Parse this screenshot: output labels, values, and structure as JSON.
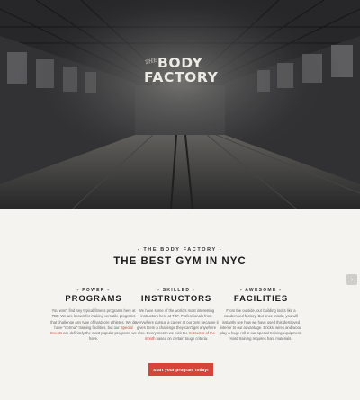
{
  "logo": {
    "the": "THE",
    "line1": "BODY",
    "line2": "FACTORY"
  },
  "intro": {
    "eyebrow": "- THE BODY FACTORY -",
    "headline": "THE BEST GYM IN NYC"
  },
  "features": [
    {
      "kicker": "- POWER -",
      "heading": "PROGRAMS",
      "text_before": "You won't find any typical fitness programs here at TBF. We are known for making versatile programs that challenge any type of hardcore athletes. We do have \"normal\" training facilities, but our ",
      "link": "Special Events",
      "text_after": " are definitely the most popular programs we have."
    },
    {
      "kicker": "- SKILLED -",
      "heading": "INSTRUCTORS",
      "text_before": "We have some of the world's most interesting instructors here at TBF. Professionals from everywhere pursue a career at our gym because it gives them a challenge they can't get anywhere else. Every month we pick the ",
      "link": "Instructor of the month",
      "text_after": " based on certain tough criteria."
    },
    {
      "kicker": "- AWESOME -",
      "heading": "FACILITIES",
      "text_before": "From the outside, our building looks like a condemned factory. But once inside, you will instantly see how we have used this destroyed interior to our advantage. Bricks, wires and wood play a huge roll in our special training equipment. Hard training requires hard materials.",
      "link": "",
      "text_after": ""
    }
  ],
  "cta": {
    "label": "Start your program today!"
  },
  "side_button": {
    "icon": "chevron-right-icon",
    "glyph": "›"
  },
  "colors": {
    "accent": "#d6443a",
    "background": "#f4f3ef",
    "hero": "#3b3b3e"
  }
}
